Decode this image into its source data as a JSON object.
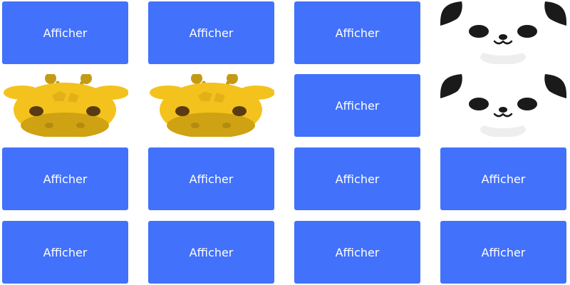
{
  "game": {
    "button_label": "Afficher",
    "colors": {
      "tile": "#4271fb",
      "tile_text": "#ffffff",
      "giraffe_face": "#f4c21c",
      "giraffe_muzzle": "#cfa213",
      "giraffe_spots": "#e2b118",
      "giraffe_ossicone": "#c49a14",
      "giraffe_eye": "#5a3a10",
      "panda_ears_eyes": "#1a1a1a",
      "panda_face": "#ffffff",
      "panda_chin": "#eeeeee"
    },
    "grid": [
      [
        {
          "state": "hidden",
          "label": "Afficher"
        },
        {
          "state": "hidden",
          "label": "Afficher"
        },
        {
          "state": "hidden",
          "label": "Afficher"
        },
        {
          "state": "revealed",
          "animal": "panda"
        }
      ],
      [
        {
          "state": "revealed",
          "animal": "giraffe"
        },
        {
          "state": "revealed",
          "animal": "giraffe"
        },
        {
          "state": "hidden",
          "label": "Afficher"
        },
        {
          "state": "revealed",
          "animal": "panda"
        }
      ],
      [
        {
          "state": "hidden",
          "label": "Afficher"
        },
        {
          "state": "hidden",
          "label": "Afficher"
        },
        {
          "state": "hidden",
          "label": "Afficher"
        },
        {
          "state": "hidden",
          "label": "Afficher"
        }
      ],
      [
        {
          "state": "hidden",
          "label": "Afficher"
        },
        {
          "state": "hidden",
          "label": "Afficher"
        },
        {
          "state": "hidden",
          "label": "Afficher"
        },
        {
          "state": "hidden",
          "label": "Afficher"
        }
      ]
    ]
  }
}
